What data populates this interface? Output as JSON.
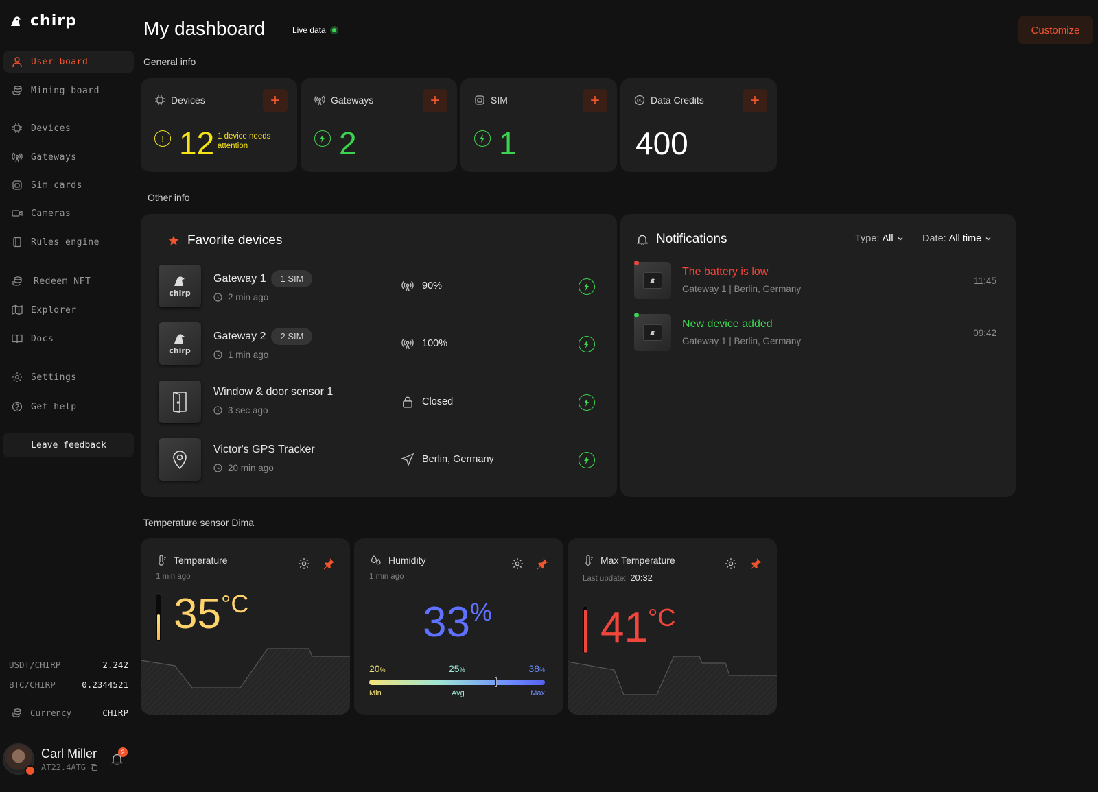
{
  "app": {
    "brand": "chirp",
    "page_title": "My dashboard",
    "live_label": "Live data",
    "customize_label": "Customize"
  },
  "sidebar": {
    "items": [
      {
        "label": "User board",
        "icon": "user-icon",
        "active": true
      },
      {
        "label": "Mining board",
        "icon": "coins-icon"
      },
      {
        "label": "Devices",
        "icon": "chip-icon"
      },
      {
        "label": "Gateways",
        "icon": "antenna-icon"
      },
      {
        "label": "Sim cards",
        "icon": "sim-icon"
      },
      {
        "label": "Cameras",
        "icon": "camera-icon"
      },
      {
        "label": "Rules engine",
        "icon": "book-icon"
      },
      {
        "label": "Redeem NFT",
        "icon": "coins-icon"
      },
      {
        "label": "Explorer",
        "icon": "map-icon"
      },
      {
        "label": "Docs",
        "icon": "book-open-icon"
      },
      {
        "label": "Settings",
        "icon": "gear-icon"
      },
      {
        "label": "Get help",
        "icon": "help-icon"
      }
    ],
    "feedback_label": "Leave feedback",
    "rates": [
      {
        "pair": "USDT/CHIRP",
        "value": "2.242"
      },
      {
        "pair": "BTC/CHIRP",
        "value": "0.2344521"
      }
    ],
    "currency": {
      "label": "Currency",
      "value": "CHIRP"
    },
    "user": {
      "name": "Carl Miller",
      "id": "AT22.4ATG",
      "notifications": "2"
    }
  },
  "general": {
    "section_label": "General info",
    "cards": [
      {
        "label": "Devices",
        "value": "12",
        "note": "1 device needs attention",
        "status": "warning"
      },
      {
        "label": "Gateways",
        "value": "2",
        "status": "ok"
      },
      {
        "label": "SIM",
        "value": "1",
        "status": "ok"
      },
      {
        "label": "Data Credits",
        "value": "400"
      }
    ]
  },
  "other": {
    "section_label": "Other info",
    "favorites": {
      "title": "Favorite devices",
      "devices": [
        {
          "name": "Gateway 1",
          "badge": "1 SIM",
          "time": "2 min ago",
          "status": "90%",
          "status_icon": "antenna-icon"
        },
        {
          "name": "Gateway 2",
          "badge": "2 SIM",
          "time": "1 min ago",
          "status": "100%",
          "status_icon": "antenna-icon"
        },
        {
          "name": "Window & door sensor 1",
          "time": "3 sec ago",
          "status": "Closed",
          "status_icon": "lock-icon"
        },
        {
          "name": "Victor's GPS Tracker",
          "time": "20 min ago",
          "status": "Berlin, Germany",
          "status_icon": "navigation-icon"
        }
      ]
    },
    "notifications": {
      "title": "Notifications",
      "type_label": "Type:",
      "type_value": "All",
      "date_label": "Date:",
      "date_value": "All time",
      "items": [
        {
          "title": "The battery is low",
          "source": "Gateway 1 | Berlin, Germany",
          "time": "11:45",
          "color": "#f0463c"
        },
        {
          "title": "New device added",
          "source": "Gateway 1 | Berlin, Germany",
          "time": "09:42",
          "color": "#3bd44f"
        }
      ]
    }
  },
  "sensor": {
    "section_label": "Temperature sensor Dima",
    "temperature": {
      "label": "Temperature",
      "updated": "1 min ago",
      "value": "35",
      "unit": "°C",
      "level": 0.55,
      "color": "#ffd36b"
    },
    "humidity": {
      "label": "Humidity",
      "updated": "1 min ago",
      "value": "33",
      "unit": "%",
      "min": "20",
      "avg": "25",
      "max": "38",
      "unit_small": "%",
      "min_label": "Min",
      "avg_label": "Avg",
      "max_label": "Max",
      "color": "#5e72ff"
    },
    "max_temperature": {
      "label": "Max Temperature",
      "updated_label": "Last update:",
      "updated_value": "20:32",
      "value": "41",
      "unit": "°C",
      "level": 0.9,
      "color": "#f0463c"
    }
  },
  "colors": {
    "accent": "#f2542d",
    "ok": "#3bd44f",
    "warning": "#f5e31a"
  }
}
